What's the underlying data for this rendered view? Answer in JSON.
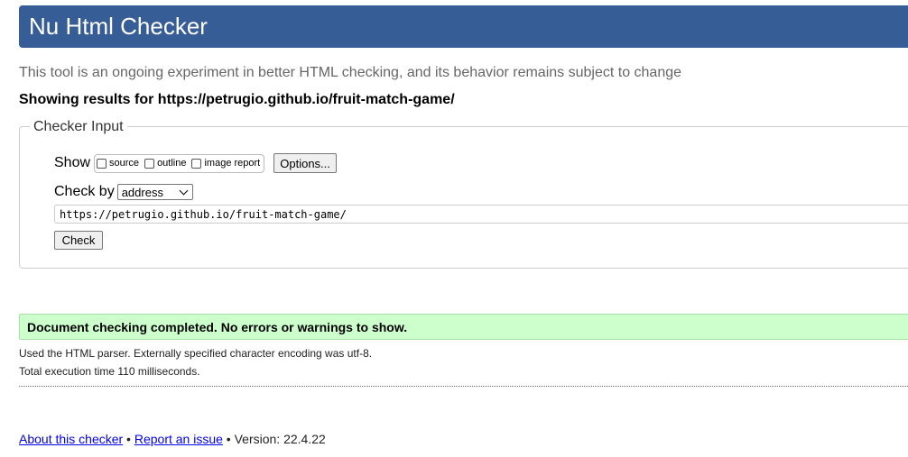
{
  "header": {
    "title": "Nu Html Checker"
  },
  "tagline": "This tool is an ongoing experiment in better HTML checking, and its behavior remains subject to change",
  "showing_results": "Showing results for https://petrugio.github.io/fruit-match-game/",
  "checker_input": {
    "legend": "Checker Input",
    "show_label": "Show",
    "show_options": [
      {
        "label": "source",
        "checked": false
      },
      {
        "label": "outline",
        "checked": false
      },
      {
        "label": "image report",
        "checked": false
      }
    ],
    "options_button": "Options...",
    "check_by_label": "Check by",
    "check_by_selected": "address",
    "url_value": "https://petrugio.github.io/fruit-match-game/",
    "check_button": "Check"
  },
  "result": {
    "message": "Document checking completed. No errors or warnings to show.",
    "parser_info": "Used the HTML parser. Externally specified character encoding was utf-8.",
    "execution_time": "Total execution time 110 milliseconds."
  },
  "footer": {
    "about_link": "About this checker",
    "separator": " • ",
    "report_link": "Report an issue",
    "version": "Version: 22.4.22"
  },
  "colors": {
    "header_bg": "#365d95",
    "success_bg": "#ccffcc",
    "link": "#0000ee"
  }
}
